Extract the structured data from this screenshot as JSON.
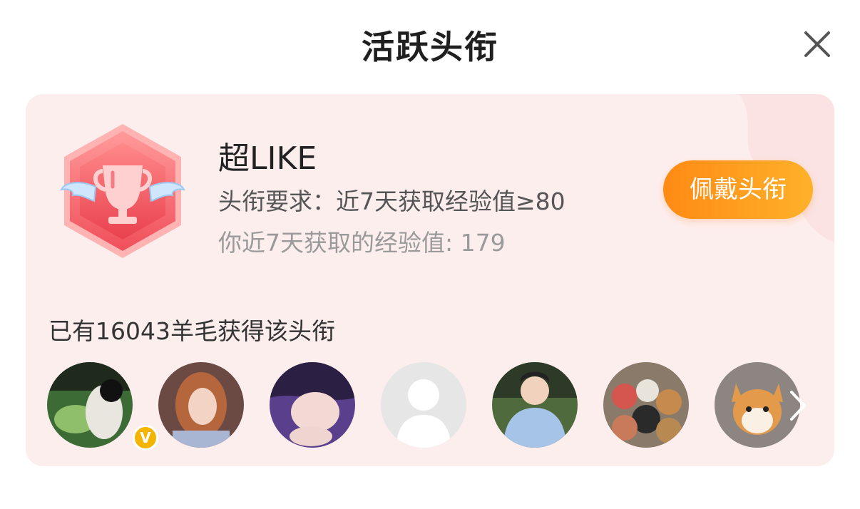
{
  "dialog": {
    "title": "活跃头衔"
  },
  "title_card": {
    "name": "超LIKE",
    "requirement": "头衔要求：近7天获取经验值≥80",
    "your_exp": "你近7天获取的经验值: 179",
    "wear_button_label": "佩戴头衔",
    "owners_text": "已有16043羊毛获得该头衔",
    "badge_icon": "trophy-with-wings-hexagon-icon",
    "accent_color": "#ff9a1f",
    "card_bg_color": "#fdeeee"
  },
  "avatars": [
    {
      "name": "avatar-1",
      "verified": true,
      "verified_mark": "V"
    },
    {
      "name": "avatar-2"
    },
    {
      "name": "avatar-3"
    },
    {
      "name": "avatar-4-default"
    },
    {
      "name": "avatar-5"
    },
    {
      "name": "avatar-6"
    },
    {
      "name": "avatar-7-shiba"
    }
  ],
  "icons": {
    "close": "close-icon",
    "more": "chevron-right-icon"
  }
}
